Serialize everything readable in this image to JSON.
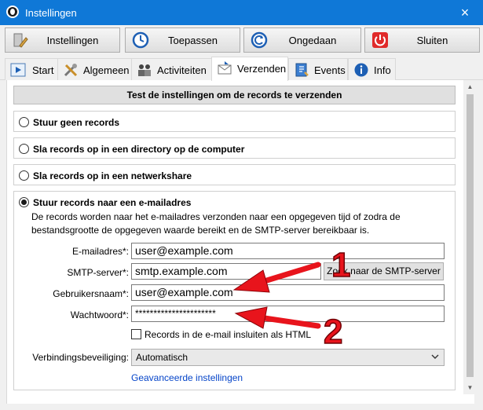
{
  "window": {
    "title": "Instellingen",
    "close_glyph": "×"
  },
  "toolbar": {
    "buttons": [
      {
        "label": "Instellingen",
        "icon": "settings-wrench-icon"
      },
      {
        "label": "Toepassen",
        "icon": "clock-check-icon"
      },
      {
        "label": "Ongedaan",
        "icon": "undo-icon"
      },
      {
        "label": "Sluiten",
        "icon": "power-icon"
      }
    ]
  },
  "tabs": [
    {
      "label": "Start",
      "icon": "play-icon"
    },
    {
      "label": "Algemeen",
      "icon": "tools-icon"
    },
    {
      "label": "Activiteiten",
      "icon": "people-icon"
    },
    {
      "label": "Verzenden",
      "icon": "mail-send-icon",
      "active": true
    },
    {
      "label": "Events",
      "icon": "notebook-icon"
    },
    {
      "label": "Info",
      "icon": "info-icon"
    }
  ],
  "main": {
    "header": "Test de instellingen om de records te verzenden",
    "options": [
      {
        "label": "Stuur geen records",
        "checked": false
      },
      {
        "label": "Sla records op in een directory op de computer",
        "checked": false
      },
      {
        "label": "Sla records op in een netwerkshare",
        "checked": false
      },
      {
        "label": "Stuur records naar een e-mailadres",
        "checked": true
      }
    ],
    "description": "De records worden naar het e-mailadres verzonden naar een opgegeven tijd of zodra de bestandsgrootte de opgegeven waarde bereikt en de SMTP-server bereikbaar is.",
    "fields": {
      "email_label": "E-mailadres*:",
      "email_value": "user@example.com",
      "smtp_label": "SMTP-server*:",
      "smtp_value": "smtp.example.com",
      "smtp_button": "Zoek naar de SMTP-server",
      "user_label": "Gebruikersnaam*:",
      "user_value": "user@example.com",
      "password_label": "Wachtwoord*:",
      "password_value": "**********************"
    },
    "html_checkbox_label": "Records in de e-mail insluiten als HTML",
    "security_label": "Verbindingsbeveiliging:",
    "security_value": "Automatisch",
    "advanced_link": "Geavanceerde instellingen"
  },
  "annotations": {
    "one": "1",
    "two": "2",
    "color": "#e8141c"
  },
  "colors": {
    "titlebar": "#0f78d7",
    "link": "#0645c9"
  }
}
